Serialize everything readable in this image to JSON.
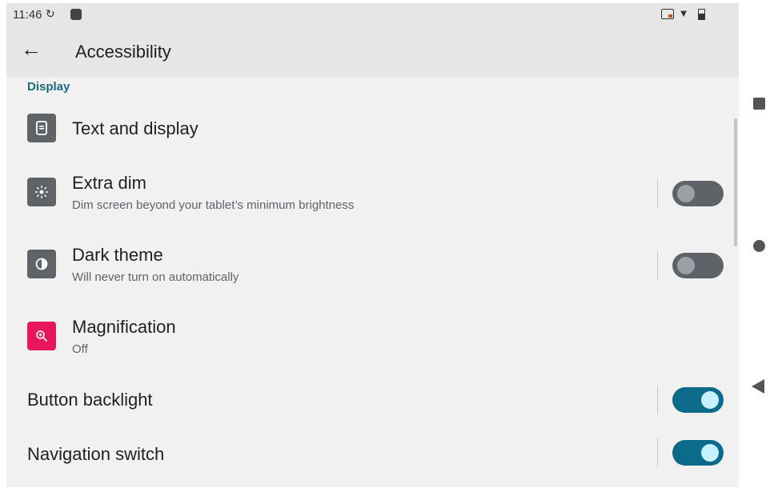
{
  "status_bar": {
    "time": "11:46",
    "icons": [
      "sync-icon",
      "app-notification-icon",
      "cast-icon",
      "wifi-icon",
      "battery-icon"
    ]
  },
  "app_bar": {
    "title": "Accessibility"
  },
  "section": {
    "label": "Display"
  },
  "items": [
    {
      "title": "Text and display",
      "icon": "text-display-icon"
    },
    {
      "title": "Extra dim",
      "subtitle": "Dim screen beyond your tablet’s minimum brightness",
      "icon": "extra-dim-icon",
      "toggle": false
    },
    {
      "title": "Dark theme",
      "subtitle": "Will never turn on automatically",
      "icon": "dark-theme-icon",
      "toggle": false
    },
    {
      "title": "Magnification",
      "subtitle": "Off",
      "icon": "magnification-icon"
    },
    {
      "title": "Button backlight",
      "toggle": true
    },
    {
      "title": "Navigation switch",
      "toggle": true
    }
  ],
  "colors": {
    "accent": "#0c6a8a",
    "section_header": "#1b6a7e",
    "magnification_icon_bg": "#e8175d",
    "icon_bg": "#5f6368"
  }
}
